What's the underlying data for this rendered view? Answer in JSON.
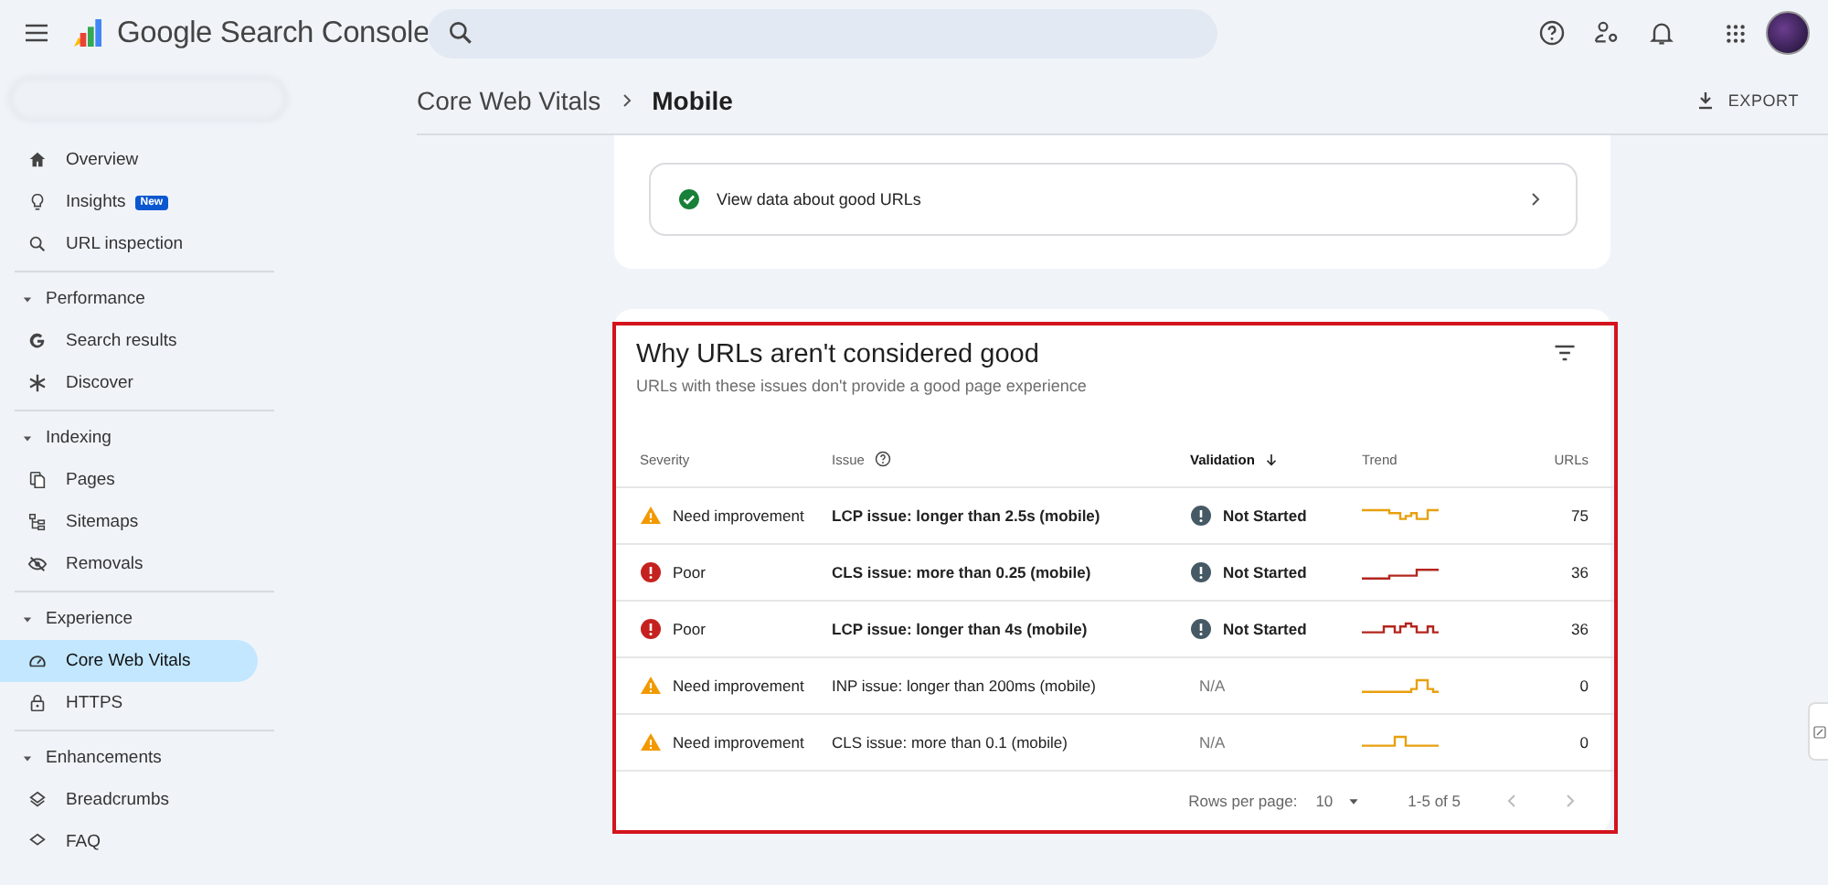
{
  "header": {
    "product": "Google Search Console"
  },
  "sidebar": {
    "items": [
      {
        "label": "Overview",
        "selected": false
      },
      {
        "label": "Insights",
        "selected": false,
        "badge": "New"
      },
      {
        "label": "URL inspection",
        "selected": false
      }
    ],
    "sections": [
      {
        "label": "Performance",
        "expanded": true,
        "items": [
          {
            "label": "Search results",
            "selected": false
          },
          {
            "label": "Discover",
            "selected": false
          }
        ]
      },
      {
        "label": "Indexing",
        "expanded": true,
        "items": [
          {
            "label": "Pages",
            "selected": false
          },
          {
            "label": "Sitemaps",
            "selected": false
          },
          {
            "label": "Removals",
            "selected": false
          }
        ]
      },
      {
        "label": "Experience",
        "expanded": true,
        "items": [
          {
            "label": "Core Web Vitals",
            "selected": true
          },
          {
            "label": "HTTPS",
            "selected": false
          }
        ]
      },
      {
        "label": "Enhancements",
        "expanded": true,
        "items": [
          {
            "label": "Breadcrumbs",
            "selected": false
          },
          {
            "label": "FAQ",
            "selected": false
          }
        ]
      }
    ]
  },
  "breadcrumb": [
    "Core Web Vitals",
    "Mobile"
  ],
  "export_label": "EXPORT",
  "good_urls_link": "View data about good URLs",
  "issues": {
    "title": "Why URLs aren't considered good",
    "subtitle": "URLs with these issues don't provide a good page experience",
    "highlighted": true,
    "columns": [
      {
        "label": "Severity",
        "sorted": false,
        "help": false
      },
      {
        "label": "Issue",
        "sorted": false,
        "help": true
      },
      {
        "label": "Validation",
        "sorted": true,
        "help": false
      },
      {
        "label": "Trend",
        "sorted": false,
        "help": false
      },
      {
        "label": "URLs",
        "sorted": false,
        "help": false
      }
    ],
    "rows": [
      {
        "severity": {
          "kind": "warning",
          "label": "Need improvement"
        },
        "issue": "LCP issue: longer than 2.5s (mobile)",
        "validation": {
          "kind": "not_started",
          "label": "Not Started"
        },
        "urls": "75"
      },
      {
        "severity": {
          "kind": "error",
          "label": "Poor"
        },
        "issue": "CLS issue: more than 0.25 (mobile)",
        "validation": {
          "kind": "not_started",
          "label": "Not Started"
        },
        "urls": "36"
      },
      {
        "severity": {
          "kind": "error",
          "label": "Poor"
        },
        "issue": "LCP issue: longer than 4s (mobile)",
        "validation": {
          "kind": "not_started",
          "label": "Not Started"
        },
        "urls": "36"
      },
      {
        "severity": {
          "kind": "warning",
          "label": "Need improvement"
        },
        "issue": "INP issue: longer than 200ms (mobile)",
        "validation": {
          "kind": "na",
          "label": "N/A"
        },
        "urls": "0"
      },
      {
        "severity": {
          "kind": "warning",
          "label": "Need improvement"
        },
        "issue": "CLS issue: more than 0.1 (mobile)",
        "validation": {
          "kind": "na",
          "label": "N/A"
        },
        "urls": "0"
      }
    ],
    "footer": {
      "rows_per_page_label": "Rows per page:",
      "rows_per_page": "10",
      "range": "1-5 of 5"
    }
  }
}
